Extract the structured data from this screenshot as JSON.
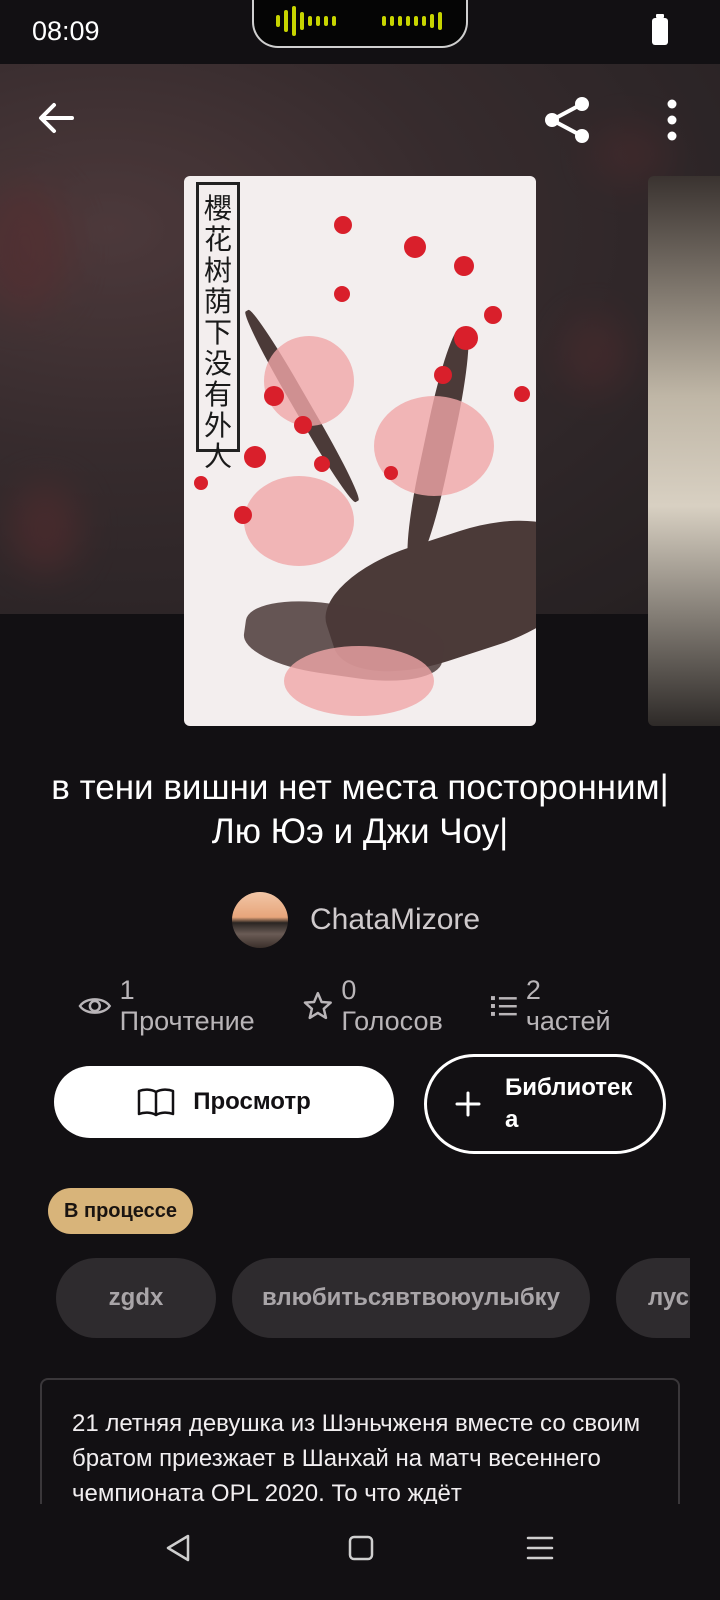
{
  "status_bar": {
    "time": "08:09"
  },
  "top_bar": {
    "back_icon": "arrow-left-icon",
    "share_icon": "share-icon",
    "more_icon": "more-vertical-icon"
  },
  "cover": {
    "title_chars": [
      "櫻",
      "花",
      "树",
      "荫",
      "下",
      "没",
      "有",
      "外",
      "人"
    ]
  },
  "book": {
    "title": "в тени вишни нет места посторонним|Лю Юэ и Джи Чоу|",
    "author": "ChataMizore",
    "stats": {
      "reads": "1 Прочтение",
      "votes": "0 Голосов",
      "parts": "2 частей"
    },
    "status": "В процессе",
    "tags": [
      "zgdx",
      "влюбитьсявтвоюулыбку",
      "лус"
    ],
    "description": "21 летняя девушка из Шэньчженя вместе со своим братом приезжает в Шанхай на матч весеннего чемпионата  OPL 2020. То что ждёт"
  },
  "actions": {
    "read_label": "Просмотр",
    "library_label": "Библиотека"
  },
  "colors": {
    "badge": "#d8b47a",
    "background": "#121013",
    "tag_bg": "#2e2b2e"
  },
  "nav_bar": {
    "icons": [
      "back-triangle-icon",
      "home-square-icon",
      "menu-lines-icon"
    ]
  }
}
